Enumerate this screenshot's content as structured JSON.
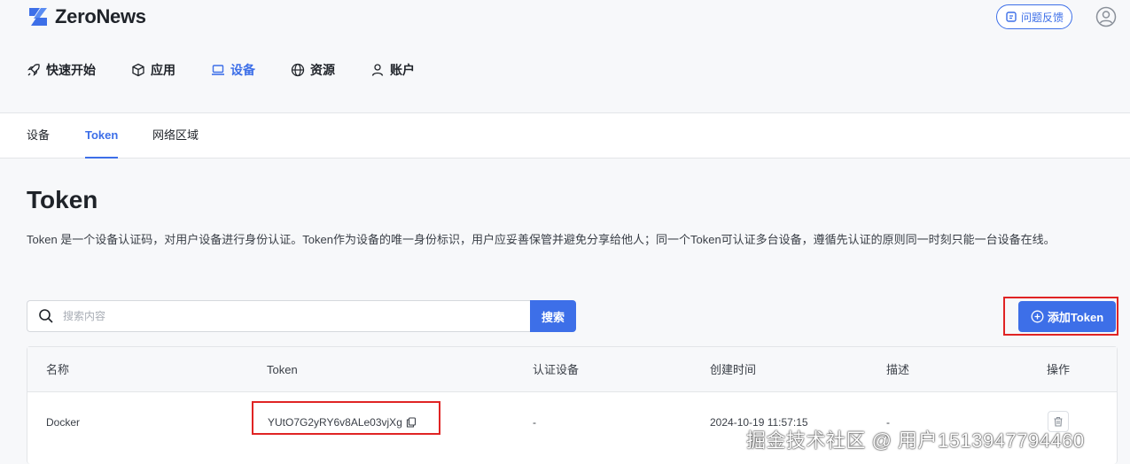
{
  "header": {
    "brand": "ZeroNews",
    "feedback_label": "问题反馈",
    "nav": [
      {
        "label": "快速开始",
        "icon": "rocket-icon"
      },
      {
        "label": "应用",
        "icon": "cube-icon"
      },
      {
        "label": "设备",
        "icon": "laptop-icon",
        "active": true
      },
      {
        "label": "资源",
        "icon": "globe-icon"
      },
      {
        "label": "账户",
        "icon": "user-icon"
      }
    ]
  },
  "subtabs": [
    {
      "label": "设备"
    },
    {
      "label": "Token",
      "active": true
    },
    {
      "label": "网络区域"
    }
  ],
  "page": {
    "title": "Token",
    "description": "Token 是一个设备认证码，对用户设备进行身份认证。Token作为设备的唯一身份标识，用户应妥善保管并避免分享给他人；同一个Token可认证多台设备，遵循先认证的原则同一时刻只能一台设备在线。"
  },
  "search": {
    "placeholder": "搜索内容",
    "value": "",
    "button_label": "搜索"
  },
  "add_button_label": "添加Token",
  "table": {
    "columns": [
      "名称",
      "Token",
      "认证设备",
      "创建时间",
      "描述",
      "操作"
    ],
    "rows": [
      {
        "name": "Docker",
        "token": "YUtO7G2yRY6v8ALe03vjXg",
        "device": "-",
        "created": "2024-10-19 11:57:15",
        "description": "-"
      }
    ]
  },
  "watermark": "掘金技术社区 @ 用户1513947794460",
  "colors": {
    "accent": "#3d6fe8",
    "highlight_box": "#e02424",
    "page_bg": "#f7f8fa"
  }
}
